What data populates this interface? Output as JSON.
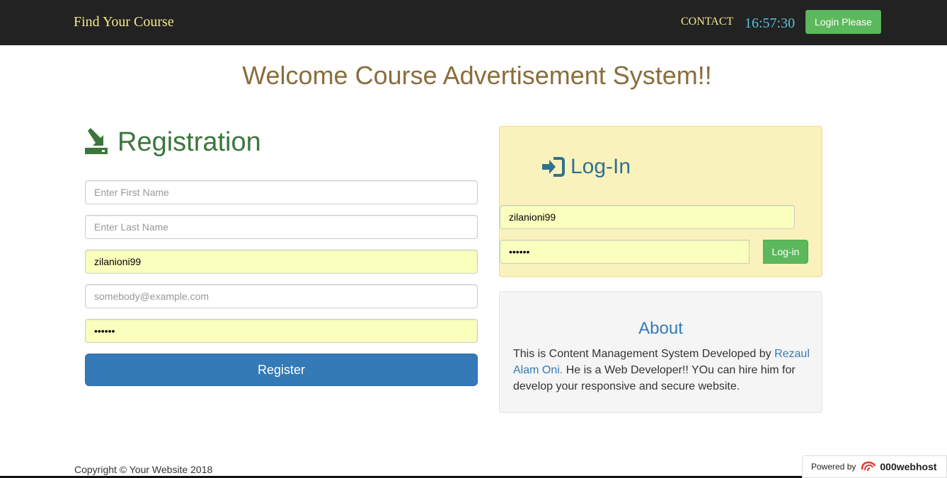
{
  "navbar": {
    "brand": "Find Your Course",
    "contact": "CONTACT",
    "clock": "16:57:30",
    "login_button": "Login Please"
  },
  "welcome": "Welcome Course Advertisement System!!",
  "registration": {
    "title": "Registration",
    "first_name": {
      "placeholder": "Enter First Name",
      "value": ""
    },
    "last_name": {
      "placeholder": "Enter Last Name",
      "value": ""
    },
    "username": {
      "value": "zilanioni99"
    },
    "email": {
      "placeholder": "somebody@example.com",
      "value": ""
    },
    "password": {
      "value": "••••••"
    },
    "submit": "Register"
  },
  "login": {
    "title": "Log-In",
    "username": {
      "value": "zilanioni99"
    },
    "password": {
      "value": "••••••"
    },
    "submit": "Log-in"
  },
  "about": {
    "title": "About",
    "text_before": "This is Content Management System Developed by",
    "author": "Rezaul Alam Oni.",
    "text_after": "He is a Web Developer!! YOu can hire him for develop your responsive and secure website."
  },
  "footer": {
    "copyright": "Copyright © Your Website 2018",
    "powered_by": "Powered by",
    "host": "000webhost"
  },
  "colors": {
    "navbar_bg": "#222222",
    "brand": "#f2e78c",
    "clock": "#5bc0de",
    "success": "#5cb85c",
    "primary": "#337ab7",
    "welcome": "#8a6d3b",
    "registration_title": "#3c763d",
    "autofill": "#faffbd"
  }
}
